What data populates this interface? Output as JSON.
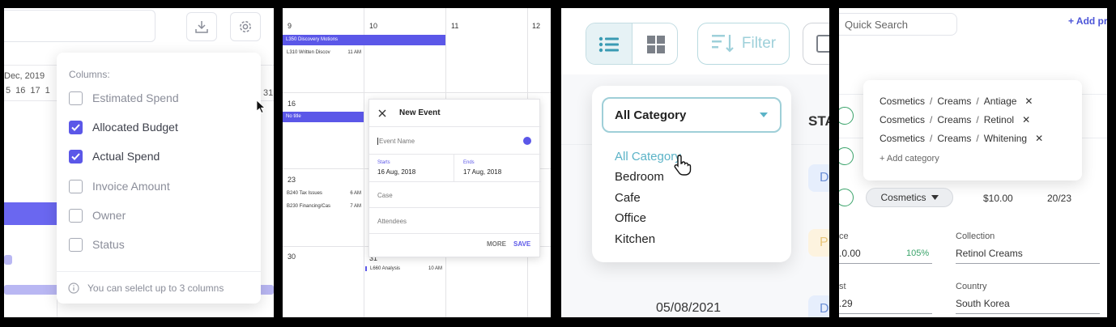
{
  "panel1": {
    "month_label": "Dec, 2019",
    "days": [
      "5",
      "16",
      "17",
      "1"
    ],
    "day_right": "31",
    "columns_title": "Columns:",
    "options": [
      {
        "label": "Estimated Spend",
        "checked": false
      },
      {
        "label": "Allocated Budget",
        "checked": true
      },
      {
        "label": "Actual Spend",
        "checked": true
      },
      {
        "label": "Invoice Amount",
        "checked": false
      },
      {
        "label": "Owner",
        "checked": false
      },
      {
        "label": "Status",
        "checked": false
      }
    ],
    "footer_note": "You can selelct up to 3 columns",
    "icons": {
      "download": "download-icon",
      "settings": "gear-icon",
      "info": "info-icon"
    }
  },
  "panel2": {
    "cols": [
      "9",
      "10",
      "11",
      "12"
    ],
    "row2_num": "16",
    "row3_num": "23",
    "row4_nums": [
      "30",
      "31"
    ],
    "events": {
      "e1": "L350 Discovery Motions",
      "e2_name": "L310 Written Discov",
      "e2_time": "11 AM",
      "e3": "No title",
      "e4_name": "B240 Tax Issues",
      "e4_time": "6 AM",
      "e5_name": "B230 Financing/Cas",
      "e5_time": "7 AM",
      "e6_name": "L660 Analysis",
      "e6_time": "10 AM"
    },
    "new_event": {
      "title": "New Event",
      "name_placeholder": "Event Name",
      "starts_label": "Starts",
      "starts_value": "16 Aug, 2018",
      "ends_label": "Ends",
      "ends_value": "17 Aug, 2018",
      "case_placeholder": "Case",
      "attendees_placeholder": "Attendees",
      "more": "MORE",
      "save": "SAVE"
    }
  },
  "panel3": {
    "filter_label": "Filter",
    "select_value": "All Category",
    "options": [
      "All Category",
      "Bedroom",
      "Cafe",
      "Office",
      "Kitchen"
    ],
    "selected_index": 0,
    "status_header": "STA",
    "date": "05/08/2021",
    "badge_letters": [
      "D",
      "P",
      "D"
    ]
  },
  "panel4": {
    "search_placeholder": "Quick Search",
    "add_label": "+ Add pr",
    "tags": [
      [
        "Cosmetics",
        "Creams",
        "Antiage"
      ],
      [
        "Cosmetics",
        "Creams",
        "Retinol"
      ],
      [
        "Cosmetics",
        "Creams",
        "Whitening"
      ]
    ],
    "add_category": "+ Add category",
    "chip": "Cosmetics",
    "price": "$10.00",
    "ratio": "20/23",
    "price_label": "ce",
    "price_value": ".0.00",
    "percent": "105%",
    "collection_label": "Collection",
    "collection_value": "Retinol Creams",
    "cost_label": "st",
    "cost_value": ".29",
    "country_label": "Country",
    "country_value": "South Korea",
    "colors": {
      "accent": "#4c55d8",
      "green": "#3aa36a"
    }
  }
}
